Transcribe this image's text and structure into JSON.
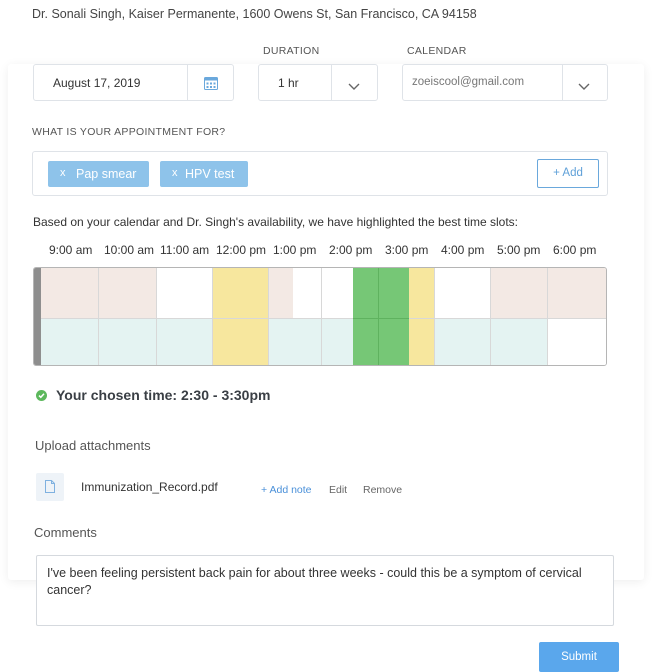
{
  "header": {
    "doctor_line": "Dr. Sonali Singh, Kaiser Permanente, 1600 Owens St, San Francisco, CA 94158"
  },
  "form": {
    "date": {
      "value": "August 17, 2019"
    },
    "duration": {
      "label": "DURATION",
      "value": "1 hr"
    },
    "calendar": {
      "label": "CALENDAR",
      "value": "zoeiscool@gmail.com"
    },
    "reason_label": "WHAT IS YOUR APPOINTMENT FOR?",
    "tags": [
      {
        "x": "x",
        "label": "Pap smear"
      },
      {
        "x": "x",
        "label": "HPV test"
      }
    ],
    "add_label": "+ Add"
  },
  "availability": {
    "intro": "Based on your calendar and Dr. Singh's availability, we have highlighted the best time slots:",
    "times": [
      "9:00 am",
      "10:00 am",
      "11:00 am",
      "12:00 pm",
      "1:00 pm",
      "2:00 pm",
      "3:00 pm",
      "4:00 pm",
      "5:00 pm",
      "6:00 pm"
    ],
    "colors": {
      "busy_top": "#f3e9e4",
      "open_bottom": "#e4f3f2",
      "free": "#ffffff",
      "good": "#f7e79e",
      "best": "#76c776",
      "current": "#8e8e8e"
    }
  },
  "chosen": {
    "label": "Your chosen time: 2:30 - 3:30pm"
  },
  "attachments": {
    "section_label": "Upload attachments",
    "file_name": "Immunization_Record.pdf",
    "add_note": "+ Add note",
    "edit": "Edit",
    "remove": "Remove"
  },
  "comments": {
    "section_label": "Comments",
    "value": "I've been feeling persistent back pain for about three weeks - could this be a symptom of cervical cancer?"
  },
  "submit_label": "Submit"
}
